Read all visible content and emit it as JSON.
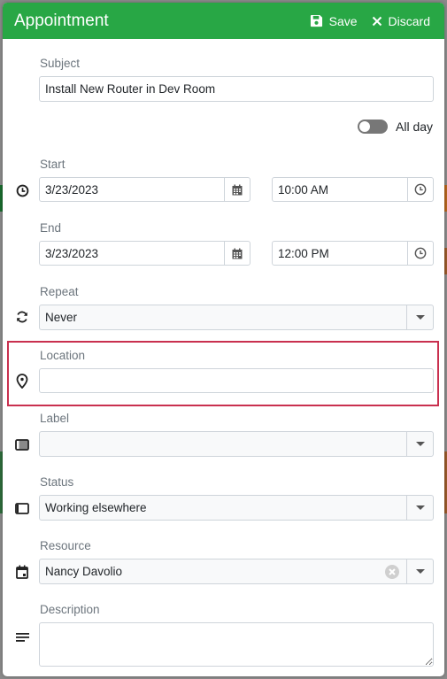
{
  "dialog": {
    "title": "Appointment",
    "save_label": "Save",
    "discard_label": "Discard",
    "accent_color": "#28a745",
    "focus_color": "#c9304f"
  },
  "form": {
    "subject": {
      "label": "Subject",
      "value": "Install New Router in Dev Room"
    },
    "all_day": {
      "label": "All day",
      "checked": false
    },
    "start": {
      "label": "Start",
      "date": "3/23/2023",
      "time": "10:00 AM"
    },
    "end": {
      "label": "End",
      "date": "3/23/2023",
      "time": "12:00 PM"
    },
    "repeat": {
      "label": "Repeat",
      "value": "Never"
    },
    "location": {
      "label": "Location",
      "value": ""
    },
    "label_field": {
      "label": "Label",
      "value": ""
    },
    "status": {
      "label": "Status",
      "value": "Working elsewhere"
    },
    "resource": {
      "label": "Resource",
      "value": "Nancy Davolio"
    },
    "description": {
      "label": "Description",
      "value": ""
    }
  }
}
